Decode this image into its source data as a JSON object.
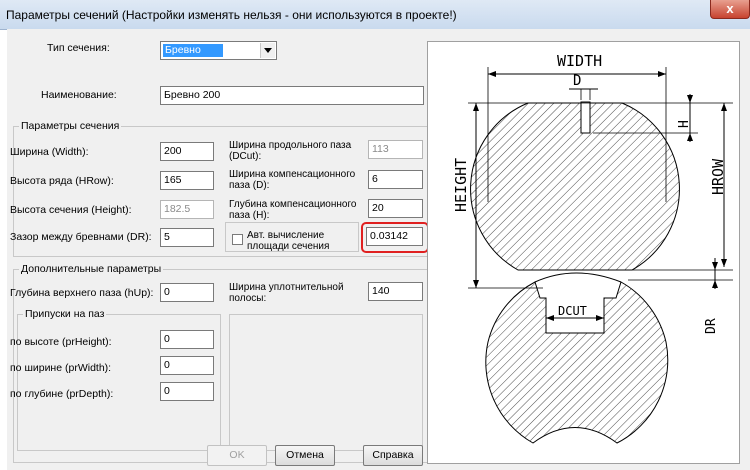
{
  "window": {
    "title": "Параметры сечений (Настройки изменять нельзя - они используются в проекте!)",
    "close_label": "x"
  },
  "form": {
    "section_type_label": "Тип сечения:",
    "section_type_value": "Бревно",
    "name_label": "Наименование:",
    "name_value": "Бревно 200"
  },
  "section_params": {
    "title": "Параметры сечения",
    "width_label": "Ширина (Width):",
    "width_value": "200",
    "hrow_label": "Высота ряда (HRow):",
    "hrow_value": "165",
    "height_label": "Высота сечения (Height):",
    "height_value": "182.5",
    "dr_label": "Зазор между бревнами (DR):",
    "dr_value": "5",
    "dcut_label": "Ширина продольного паза (DCut):",
    "dcut_value": "113",
    "d_label": "Ширина компенсационного паза (D):",
    "d_value": "6",
    "h_label": "Глубина компенсационного паза (H):",
    "h_value": "20",
    "auto_area_label": "Авт. вычисление площади сечения",
    "area_value": "0.03142"
  },
  "extra_params": {
    "title": "Дополнительные параметры",
    "hup_label": "Глубина верхнего паза (hUp):",
    "hup_value": "0",
    "seal_width_label": "Ширина уплотнительной полосы:",
    "seal_width_value": "140"
  },
  "allowances": {
    "title": "Припуски на паз",
    "prheight_label": "по высоте (prHeight):",
    "prheight_value": "0",
    "prwidth_label": "по ширине (prWidth):",
    "prwidth_value": "0",
    "prdepth_label": "по глубине (prDepth):",
    "prdepth_value": "0"
  },
  "buttons": {
    "ok": "OK",
    "cancel": "Отмена",
    "help": "Справка"
  },
  "diagram": {
    "width_label": "WIDTH",
    "d_label": "D",
    "h_label": "H",
    "hrow_label": "HROW",
    "height_label": "HEIGHT",
    "dcut_label": "DCUT",
    "dr_label": "DR"
  },
  "colors": {
    "highlight": "#e02020",
    "selection": "#3399ff"
  }
}
